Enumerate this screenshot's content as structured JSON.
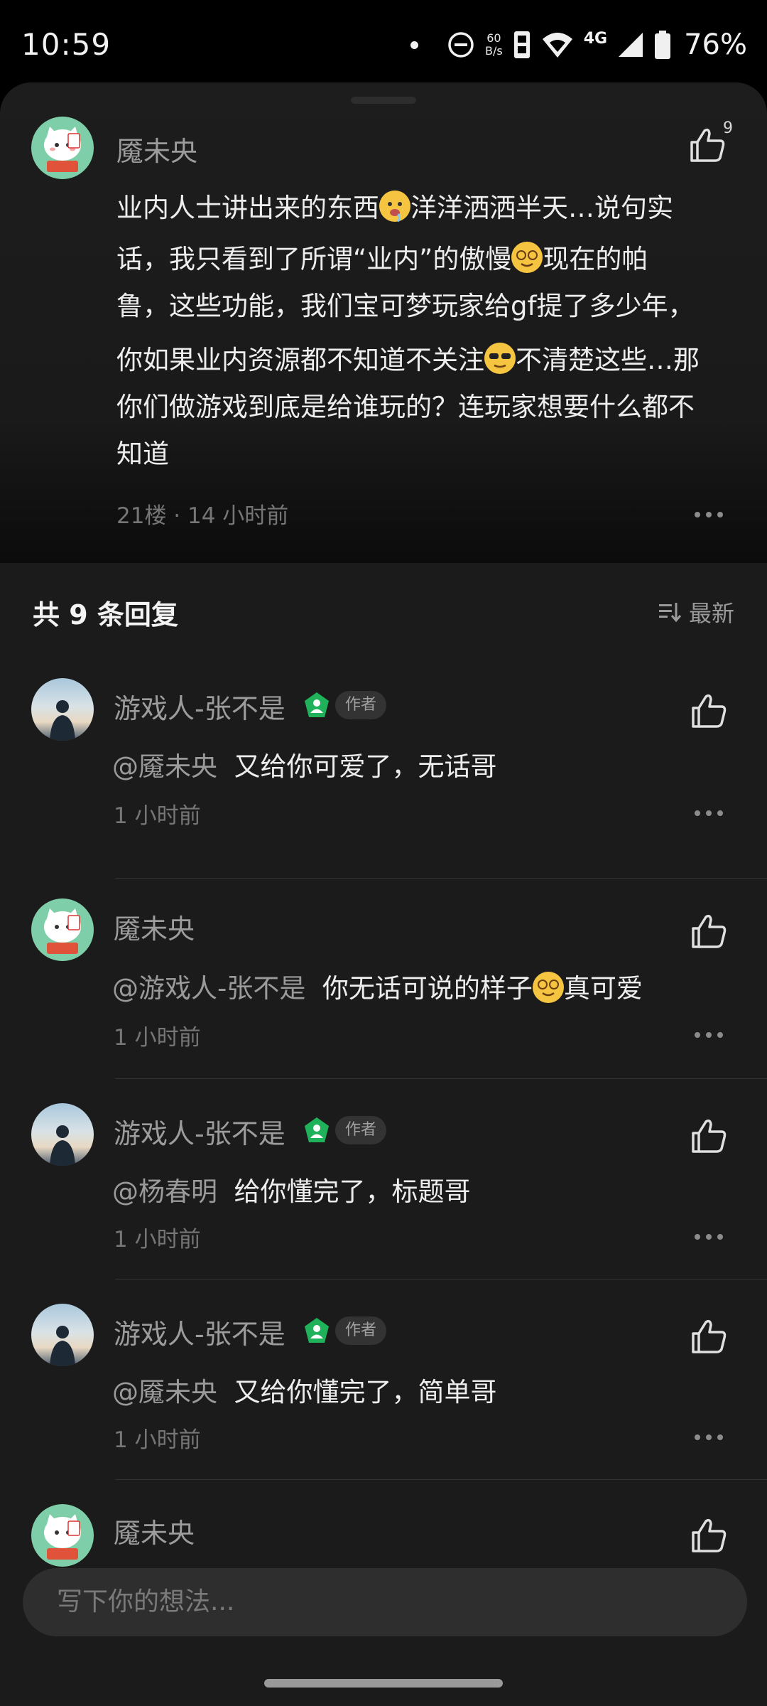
{
  "status_bar": {
    "time": "10:59",
    "net_speed_value": "60",
    "net_speed_unit": "B/s",
    "network": "4G",
    "battery": "76%"
  },
  "main_comment": {
    "author": "魇未央",
    "likes": "9",
    "line1": "业内人士讲出来的东西",
    "line1b": "洋洋洒洒半天…说句实",
    "line2": "话，我只看到了所谓“业内”的傲慢",
    "line2b": "现在的帕",
    "line3": "鲁，这些功能，我们宝可梦玩家给gf提了多少年，",
    "line4": "你如果业内资源都不知道不关注",
    "line4b": "不清楚这些…那",
    "line5": "你们做游戏到底是给谁玩的？连玩家想要什么都不",
    "line6": "知道",
    "meta": "21楼 · 14 小时前"
  },
  "replies_header": {
    "title": "共 9 条回复",
    "sort_label": "最新"
  },
  "replies": [
    {
      "author": "游戏人-张不是",
      "tag": "作者",
      "mention": "@魇未央",
      "text": "又给你可爱了，无话哥",
      "time": "1 小时前"
    },
    {
      "author": "魇未央",
      "mention": "@游戏人-张不是",
      "text": "你无话可说的样子",
      "text_b": "真可爱",
      "time": "1 小时前"
    },
    {
      "author": "游戏人-张不是",
      "tag": "作者",
      "mention": "@杨春明",
      "text": "给你懂完了，标题哥",
      "time": "1 小时前"
    },
    {
      "author": "游戏人-张不是",
      "tag": "作者",
      "mention": "@魇未央",
      "text": "又给你懂完了，简单哥",
      "time": "1 小时前"
    },
    {
      "author": "魇未央"
    }
  ],
  "input": {
    "placeholder": "写下你的想法..."
  },
  "colors": {
    "background": "#1b1b1b",
    "badge_green": "#20b25a",
    "avatar_cat_bg": "#7ecfa9"
  }
}
